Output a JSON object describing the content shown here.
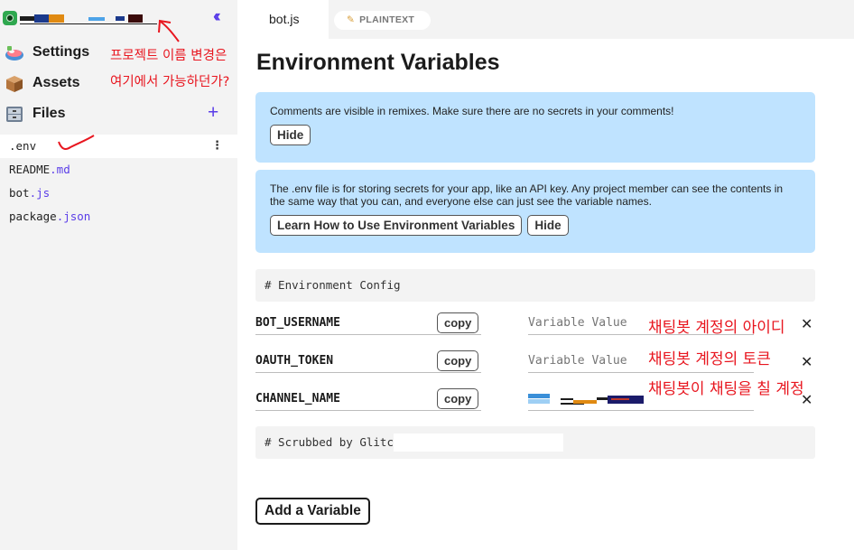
{
  "sidebar": {
    "project_name_redacted": true,
    "collapse_icon": "double-chevron-left-icon",
    "nav": [
      {
        "label": "Settings",
        "icon": "settings-sushi-icon"
      },
      {
        "label": "Assets",
        "icon": "box-icon"
      },
      {
        "label": "Files",
        "icon": "file-cabinet-icon"
      }
    ],
    "add_file_icon": "plus-icon",
    "files": [
      {
        "base": ".env",
        "ext": ""
      },
      {
        "base": "README",
        "ext": ".md"
      },
      {
        "base": "bot",
        "ext": ".js"
      },
      {
        "base": "package",
        "ext": ".json"
      }
    ],
    "file_menu": "⋮"
  },
  "annotations": {
    "project_name": [
      "프로젝트 이름 변경은",
      "여기에서 가능하던가?"
    ],
    "bot_username": "채팅봇 계정의 아이디",
    "oauth_token": "채팅봇 계정의 토큰",
    "channel_name": "채팅봇이 채팅을 칠 계정"
  },
  "tabs": {
    "active_file": "bot.js",
    "mode": "PLAINTEXT",
    "mode_icon": "pencil-icon"
  },
  "main": {
    "title": "Environment Variables",
    "notice1": {
      "text": "Comments are visible in remixes. Make sure there are no secrets in your comments!",
      "hide": "Hide"
    },
    "notice2": {
      "text": "The .env file is for storing secrets for your app, like an API key. Any project member can see the contents in the same way that you can, and everyone else can just see the variable names.",
      "learn": "Learn How to Use Environment Variables",
      "hide": "Hide"
    },
    "env_config_comment": "# Environment Config",
    "variables": [
      {
        "name": "BOT_USERNAME",
        "copy": "copy",
        "placeholder": "Variable Value",
        "value": ""
      },
      {
        "name": "OAUTH_TOKEN",
        "copy": "copy",
        "placeholder": "Variable Value",
        "value": ""
      },
      {
        "name": "CHANNEL_NAME",
        "copy": "copy",
        "placeholder": "",
        "value": "",
        "value_redacted": true
      }
    ],
    "delete_icon": "close-icon",
    "scrubbed_comment": "# Scrubbed by Glitch",
    "add_variable": "Add a Variable"
  },
  "colors": {
    "accent": "#5a3de8",
    "notice_bg": "#bfe3ff",
    "sidebar_bg": "#f3f3f3",
    "annotation": "#e8161f"
  }
}
